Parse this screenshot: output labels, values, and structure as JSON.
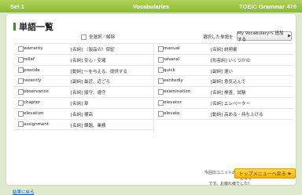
{
  "titlebar": {
    "set_label": "Set 1",
    "section_title": "Vocabularies",
    "app_title": "TOEIC Grammar 470"
  },
  "page": {
    "heading": "単語一覧",
    "select_all_label": "全選択／解除",
    "selected_words_label": "選択した単語を",
    "add_button_label": "My Vocabularyへ 追加する"
  },
  "words_left": [
    {
      "word": "warranty",
      "meaning": "[名詞] （製品の）保証"
    },
    {
      "word": "relief",
      "meaning": "[名詞] 安心・安堵"
    },
    {
      "word": "provide",
      "meaning": "[動詞] ～を与える、提供する"
    },
    {
      "word": "recently",
      "meaning": "[副詞] 最近、近ごろ"
    },
    {
      "word": "observance",
      "meaning": "[名詞] 順守、遵守"
    },
    {
      "word": "chapter",
      "meaning": "[名詞] 章"
    },
    {
      "word": "elevation",
      "meaning": "[名詞] 標高"
    },
    {
      "word": "assignment",
      "meaning": "[名詞] 課題、業務"
    }
  ],
  "words_right": [
    {
      "word": "manual",
      "meaning": "[名詞] 説明書"
    },
    {
      "word": "several",
      "meaning": "[形容詞] いくつかの"
    },
    {
      "word": "quick",
      "meaning": "[副詞] 速い"
    },
    {
      "word": "excitedly",
      "meaning": "[副詞] 意気込んで"
    },
    {
      "word": "examination",
      "meaning": "[名詞] 検査、試験"
    },
    {
      "word": "elevator",
      "meaning": "[名詞] エレベーター"
    },
    {
      "word": "elevate",
      "meaning": "[動詞] 高める・持ち上げる"
    }
  ],
  "footer": {
    "back_label": "結果に戻る",
    "note_line1": "今回のユニットの学習はここまで",
    "note_line2": "です。お疲れ様でした！",
    "top_menu_label": "トップメニューへ戻る"
  },
  "colors": {
    "titlebar_green": "#8ab935",
    "background": "#dfe9ce",
    "heading_bar": "#3d8f2c",
    "top_button": "#f2b400",
    "link_blue": "#1a5ec0"
  },
  "icons": [
    "checkbox-icon",
    "arrow-right-icon",
    "back-arrow-icon"
  ]
}
